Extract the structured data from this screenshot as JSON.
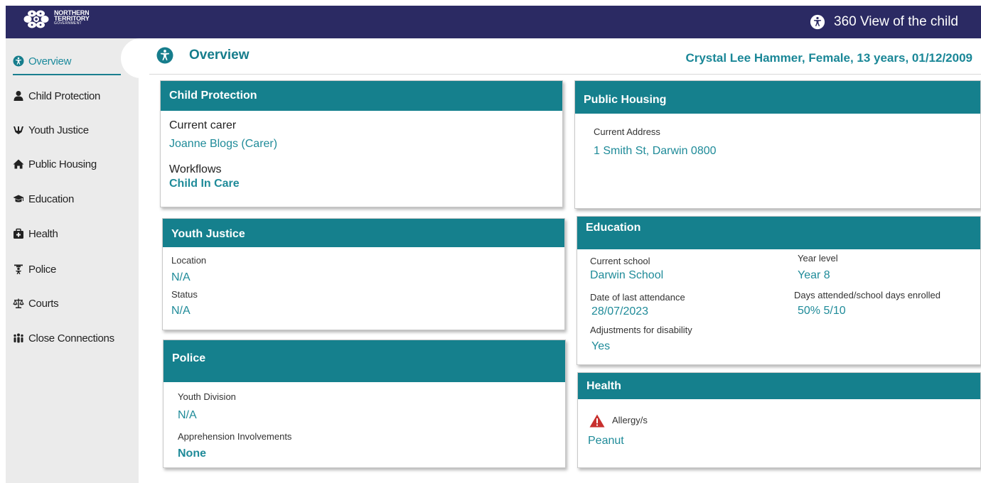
{
  "brand": {
    "line1": "NORTHERN",
    "line2": "TERRITORY",
    "line3": "GOVERNMENT"
  },
  "app": {
    "title": "360 View of the child",
    "accent": "#15808d",
    "topbar_color": "#2b2a63"
  },
  "sidebar": {
    "items": [
      {
        "label": "Overview",
        "icon": "overview-icon"
      },
      {
        "label": "Child Protection",
        "icon": "person-icon"
      },
      {
        "label": "Youth Justice",
        "icon": "youth-justice-icon"
      },
      {
        "label": "Public Housing",
        "icon": "house-icon"
      },
      {
        "label": "Education",
        "icon": "graduation-cap-icon"
      },
      {
        "label": "Health",
        "icon": "medical-kit-icon"
      },
      {
        "label": "Police",
        "icon": "police-icon"
      },
      {
        "label": "Courts",
        "icon": "scales-icon"
      },
      {
        "label": "Close Connections",
        "icon": "people-group-icon"
      }
    ]
  },
  "header": {
    "title": "Overview",
    "child_info": "Crystal Lee Hammer, Female, 13 years,  01/12/2009"
  },
  "cards": {
    "child_protection": {
      "title": "Child Protection",
      "carer_label": "Current carer",
      "carer_value": "Joanne Blogs (Carer)",
      "workflows_label": "Workflows",
      "workflows_value": "Child In Care"
    },
    "public_housing": {
      "title": "Public Housing",
      "address_label": "Current Address",
      "address_value": "1 Smith St, Darwin 0800"
    },
    "youth_justice": {
      "title": "Youth Justice",
      "location_label": "Location",
      "location_value": "N/A",
      "status_label": "Status",
      "status_value": "N/A"
    },
    "education": {
      "title": "Education",
      "school_label": "Current school",
      "school_value": "Darwin School",
      "year_label": "Year level",
      "year_value": "Year 8",
      "attendance_label": "Date of last attendance",
      "attendance_value": "28/07/2023",
      "days_label": "Days attended/school days enrolled",
      "days_value": "50% 5/10",
      "disability_label": "Adjustments for disability",
      "disability_value": "Yes"
    },
    "police": {
      "title": "Police",
      "division_label": "Youth Division",
      "division_value": "N/A",
      "apprehension_label": "Apprehension Involvements",
      "apprehension_value": "None"
    },
    "health": {
      "title": "Health",
      "allergy_label": "Allergy/s",
      "allergy_value": "Peanut"
    }
  }
}
